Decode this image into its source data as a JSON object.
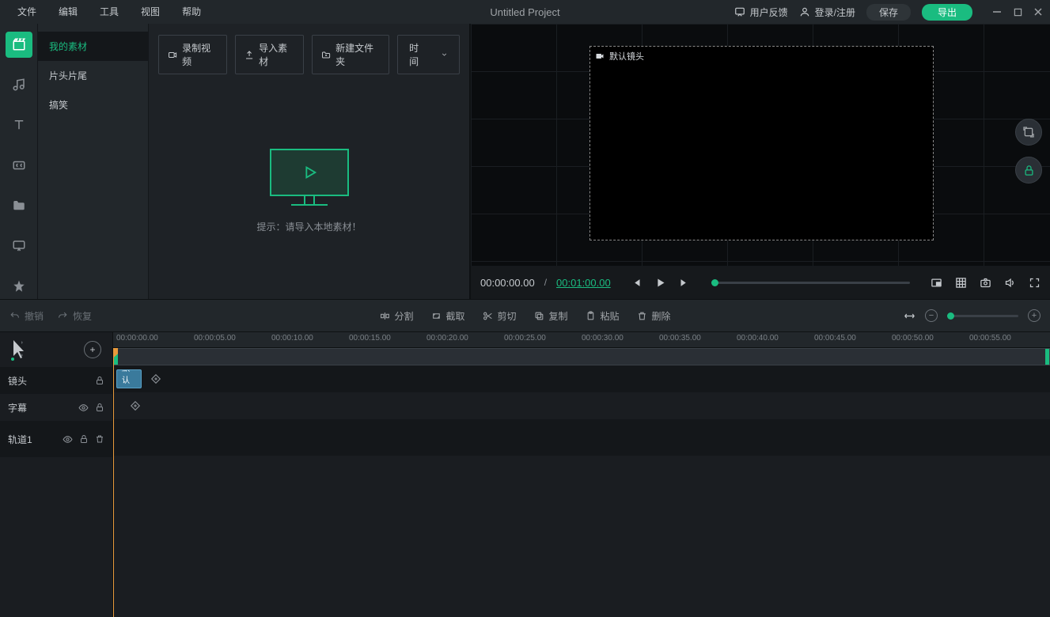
{
  "menu": {
    "file": "文件",
    "edit": "编辑",
    "tools": "工具",
    "view": "视图",
    "help": "帮助"
  },
  "title": "Untitled Project",
  "top": {
    "feedback": "用户反馈",
    "login": "登录/注册",
    "save": "保存",
    "export": "导出"
  },
  "sideList": {
    "myMedia": "我的素材",
    "openings": "片头片尾",
    "funny": "搞笑"
  },
  "mediaToolbar": {
    "record": "录制视频",
    "import": "导入素材",
    "newFolder": "新建文件夹",
    "sort": "时间"
  },
  "emptyHint": "提示：请导入本地素材！",
  "preview": {
    "defaultLabel": "默认镜头",
    "current": "00:00:00.00",
    "total": "00:01:00.00"
  },
  "editBar": {
    "undo": "撤销",
    "redo": "恢复",
    "split": "分割",
    "crop": "截取",
    "cut": "剪切",
    "copy": "复制",
    "paste": "粘贴",
    "delete": "删除"
  },
  "tracks": {
    "shot": "镜头",
    "subtitle": "字幕",
    "track1": "轨道1",
    "clip1": "默认镜"
  },
  "ruler": [
    "00:00:00.00",
    "00:00:05.00",
    "00:00:10.00",
    "00:00:15.00",
    "00:00:20.00",
    "00:00:25.00",
    "00:00:30.00",
    "00:00:35.00",
    "00:00:40.00",
    "00:00:45.00",
    "00:00:50.00",
    "00:00:55.00"
  ]
}
